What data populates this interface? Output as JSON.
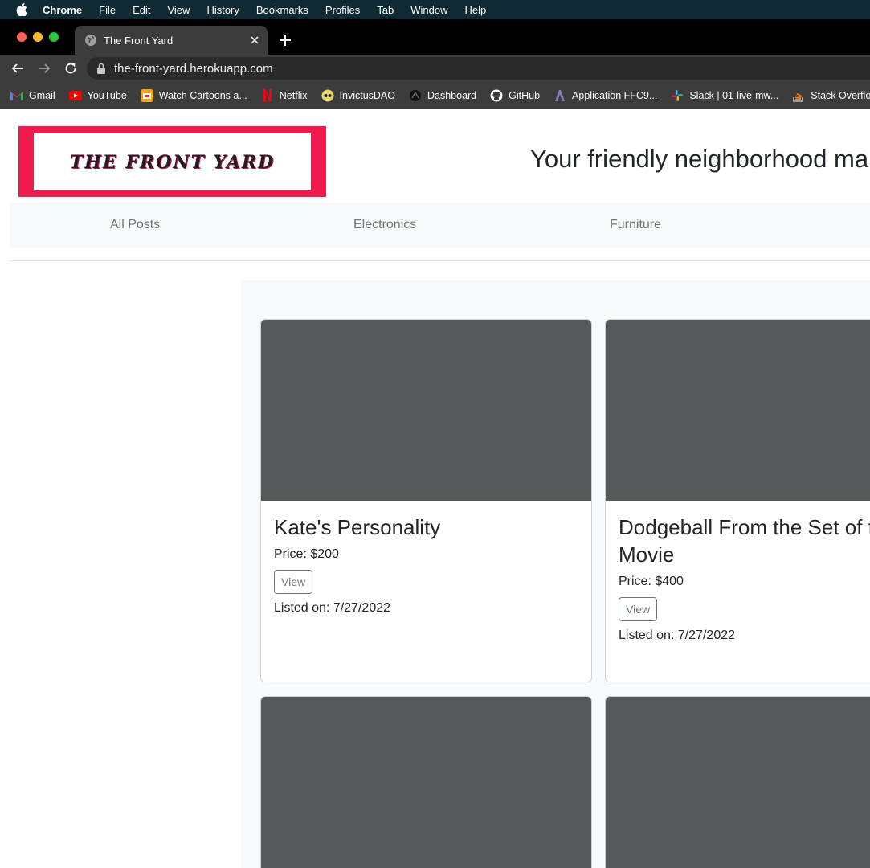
{
  "menubar": {
    "items": [
      "Chrome",
      "File",
      "Edit",
      "View",
      "History",
      "Bookmarks",
      "Profiles",
      "Tab",
      "Window",
      "Help"
    ]
  },
  "tab": {
    "title": "The Front Yard"
  },
  "omnibox": {
    "url": "the-front-yard.herokuapp.com"
  },
  "bookmarks": [
    {
      "label": "Gmail",
      "icon": "gmail-icon"
    },
    {
      "label": "YouTube",
      "icon": "youtube-icon"
    },
    {
      "label": "Watch Cartoons a...",
      "icon": "cartoons-icon"
    },
    {
      "label": "Netflix",
      "icon": "netflix-icon"
    },
    {
      "label": "InvictusDAO",
      "icon": "invictus-icon"
    },
    {
      "label": "Dashboard",
      "icon": "dashboard-icon"
    },
    {
      "label": "GitHub",
      "icon": "github-icon"
    },
    {
      "label": "Application FFC9...",
      "icon": "application-icon"
    },
    {
      "label": "Slack | 01-live-mw...",
      "icon": "slack-icon"
    },
    {
      "label": "Stack Overflow",
      "icon": "stackoverflow-icon"
    }
  ],
  "header": {
    "logo_text": "The Front Yard",
    "tagline": "Your friendly neighborhood marketplace"
  },
  "nav": {
    "items": [
      "All Posts",
      "Electronics",
      "Furniture"
    ]
  },
  "posts": [
    {
      "title": "Kate's Personality",
      "price": "Price: $200",
      "view_label": "View",
      "listed": "Listed on: 7/27/2022"
    },
    {
      "title": "Dodgeball From the Set of the Movie",
      "price": "Price: $400",
      "view_label": "View",
      "listed": "Listed on: 7/27/2022"
    }
  ],
  "colors": {
    "logo_border": "#f01a4f",
    "card_image": "#55595c",
    "menubar": "#0f2a33"
  }
}
